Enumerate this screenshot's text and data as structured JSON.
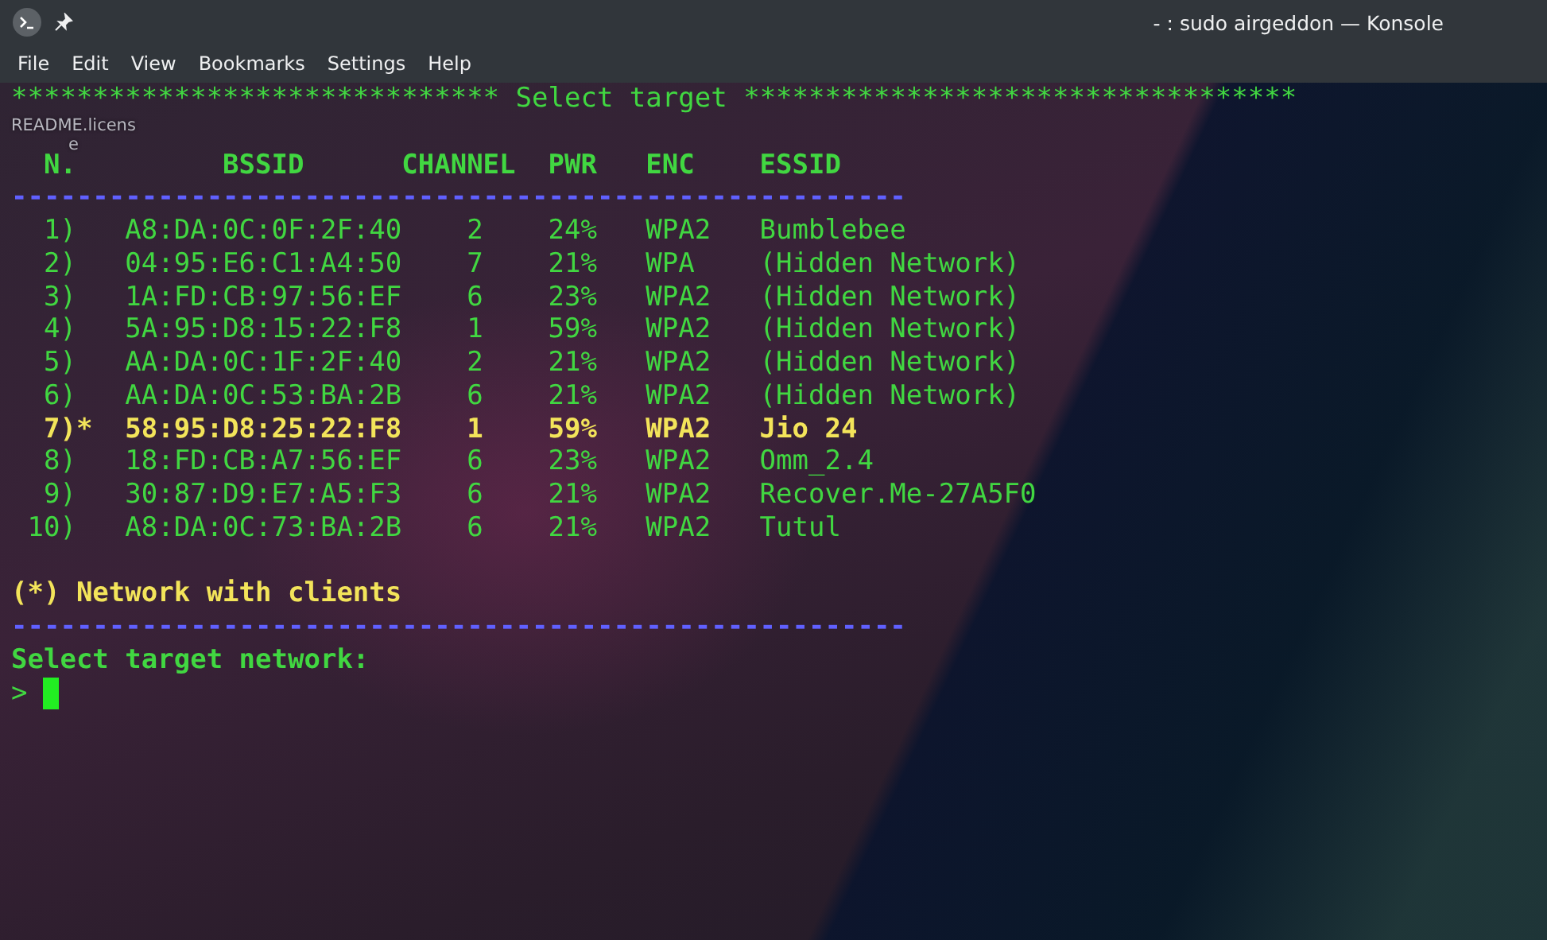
{
  "window": {
    "title": "- : sudo airgeddon — Konsole"
  },
  "menu": [
    "File",
    "Edit",
    "View",
    "Bookmarks",
    "Settings",
    "Help"
  ],
  "desktop_label": [
    "README.licens",
    "e"
  ],
  "terminal": {
    "banner_left": "******************************",
    "banner_title": "Select target",
    "banner_right": "**********************************",
    "columns": [
      "N.",
      "BSSID",
      "CHANNEL",
      "PWR",
      "ENC",
      "ESSID"
    ],
    "divider": "-------------------------------------------------------",
    "rows": [
      {
        "number": "1)",
        "marker": "",
        "clients": false,
        "bssid": "A8:DA:0C:0F:2F:40",
        "channel": "2",
        "pwr": "24%",
        "enc": "WPA2",
        "essid": "Bumblebee"
      },
      {
        "number": "2)",
        "marker": "",
        "clients": false,
        "bssid": "04:95:E6:C1:A4:50",
        "channel": "7",
        "pwr": "21%",
        "enc": "WPA",
        "essid": "(Hidden Network)"
      },
      {
        "number": "3)",
        "marker": "",
        "clients": false,
        "bssid": "1A:FD:CB:97:56:EF",
        "channel": "6",
        "pwr": "23%",
        "enc": "WPA2",
        "essid": "(Hidden Network)"
      },
      {
        "number": "4)",
        "marker": "",
        "clients": false,
        "bssid": "5A:95:D8:15:22:F8",
        "channel": "1",
        "pwr": "59%",
        "enc": "WPA2",
        "essid": "(Hidden Network)"
      },
      {
        "number": "5)",
        "marker": "",
        "clients": false,
        "bssid": "AA:DA:0C:1F:2F:40",
        "channel": "2",
        "pwr": "21%",
        "enc": "WPA2",
        "essid": "(Hidden Network)"
      },
      {
        "number": "6)",
        "marker": "",
        "clients": false,
        "bssid": "AA:DA:0C:53:BA:2B",
        "channel": "6",
        "pwr": "21%",
        "enc": "WPA2",
        "essid": "(Hidden Network)"
      },
      {
        "number": "7)",
        "marker": "*",
        "clients": true,
        "bssid": "58:95:D8:25:22:F8",
        "channel": "1",
        "pwr": "59%",
        "enc": "WPA2",
        "essid": "Jio 24"
      },
      {
        "number": "8)",
        "marker": "",
        "clients": false,
        "bssid": "18:FD:CB:A7:56:EF",
        "channel": "6",
        "pwr": "23%",
        "enc": "WPA2",
        "essid": "Omm_2.4"
      },
      {
        "number": "9)",
        "marker": "",
        "clients": false,
        "bssid": "30:87:D9:E7:A5:F3",
        "channel": "6",
        "pwr": "21%",
        "enc": "WPA2",
        "essid": "Recover.Me-27A5F0"
      },
      {
        "number": "10)",
        "marker": "",
        "clients": false,
        "bssid": "A8:DA:0C:73:BA:2B",
        "channel": "6",
        "pwr": "21%",
        "enc": "WPA2",
        "essid": "Tutul"
      }
    ],
    "legend": "(*) Network with clients",
    "divider_2": "-------------------------------------------------------",
    "prompt_label": "Select target network:",
    "prompt": ">"
  }
}
